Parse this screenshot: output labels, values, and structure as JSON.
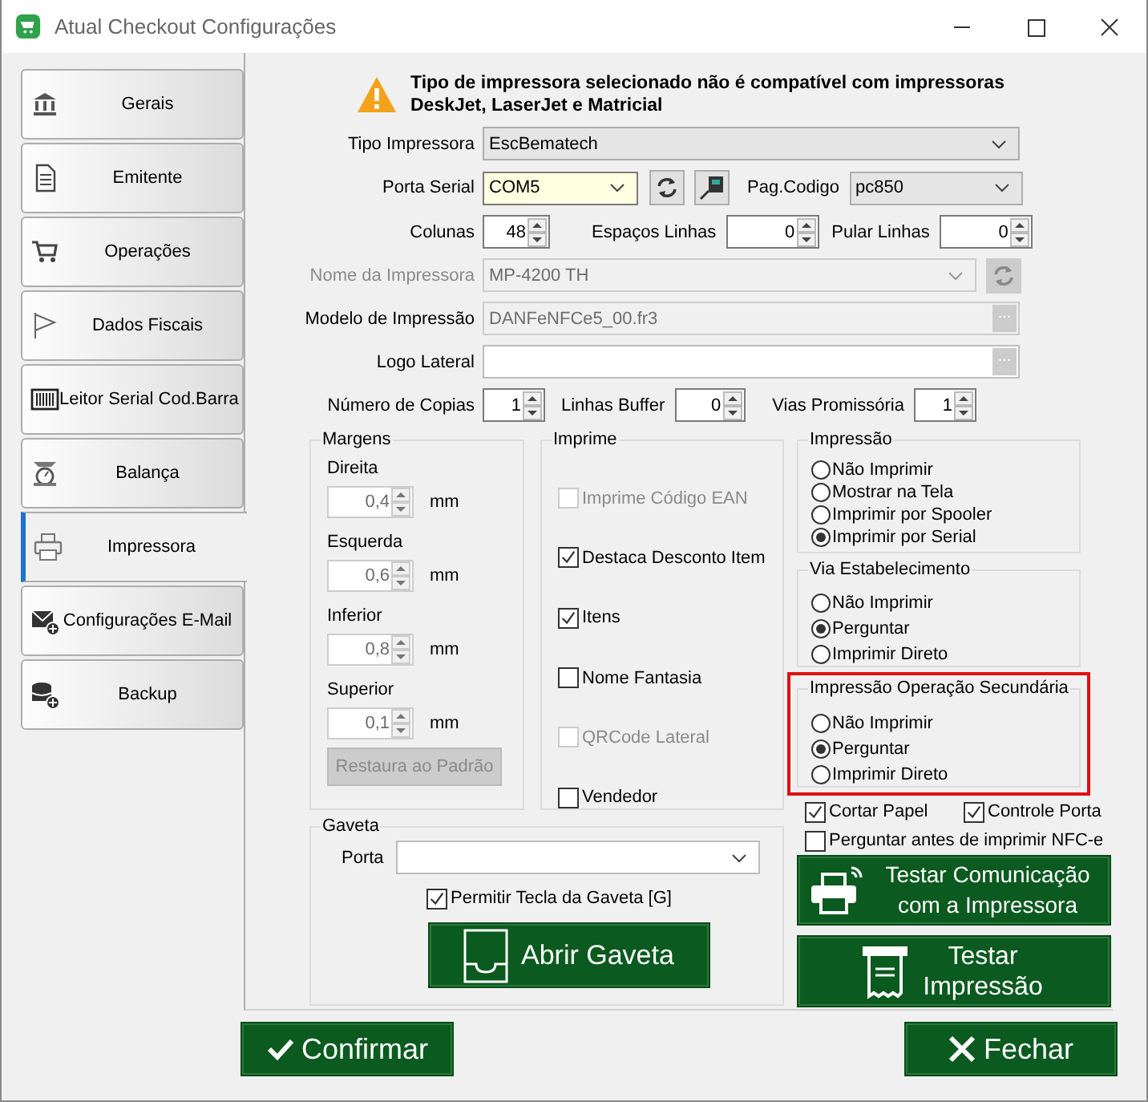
{
  "window": {
    "title": "Atual Checkout Configurações"
  },
  "sidebar": {
    "items": [
      {
        "label": "Gerais",
        "selected": false
      },
      {
        "label": "Emitente",
        "selected": false
      },
      {
        "label": "Operações",
        "selected": false
      },
      {
        "label": "Dados Fiscais",
        "selected": false
      },
      {
        "label": "Leitor Serial Cod.Barra",
        "selected": false
      },
      {
        "label": "Balança",
        "selected": false
      },
      {
        "label": "Impressora",
        "selected": true
      },
      {
        "label": "Configurações E-Mail",
        "selected": false
      },
      {
        "label": "Backup",
        "selected": false
      }
    ]
  },
  "warning": {
    "text": "Tipo de impressora selecionado não é compatível com impressoras DeskJet, LaserJet e Matricial"
  },
  "printer_type": {
    "label": "Tipo Impressora",
    "value": "EscBematech"
  },
  "serial_port": {
    "label": "Porta Serial",
    "value": "COM5"
  },
  "code_page": {
    "label": "Pag.Codigo",
    "value": "pc850"
  },
  "layout_row": [
    {
      "label": "Colunas",
      "value": "48"
    },
    {
      "label": "Espaços Linhas",
      "value": "0"
    },
    {
      "label": "Pular Linhas",
      "value": "0"
    }
  ],
  "printer_name": {
    "label": "Nome da Impressora",
    "value": "MP-4200 TH",
    "disabled": true
  },
  "print_model": {
    "label": "Modelo de Impressão",
    "value": "DANFeNFCe5_00.fr3",
    "disabled": true,
    "button_text": "..."
  },
  "side_logo": {
    "label": "Logo Lateral",
    "disabled": false,
    "button_text": "..."
  },
  "copies_row": [
    {
      "label": "Número de Copias",
      "value": "1"
    },
    {
      "label": "Linhas Buffer",
      "value": "0"
    },
    {
      "label": "Vias Promissória",
      "value": "1"
    }
  ],
  "margins": {
    "title": "Margens",
    "disabled": true,
    "items": [
      {
        "label": "Direita",
        "value": "0,4",
        "unit": "mm"
      },
      {
        "label": "Esquerda",
        "value": "0,6",
        "unit": "mm"
      },
      {
        "label": "Inferior",
        "value": "0,8",
        "unit": "mm"
      },
      {
        "label": "Superior",
        "value": "0,1",
        "unit": "mm"
      }
    ],
    "reset_button": {
      "label": "Restaura ao Padrão",
      "disabled": true
    }
  },
  "prints": {
    "title": "Imprime",
    "items": [
      {
        "label": "Imprime Código EAN",
        "checked": false,
        "disabled": true
      },
      {
        "label": "Destaca Desconto Item",
        "checked": true,
        "disabled": false
      },
      {
        "label": "Itens",
        "checked": true,
        "disabled": false
      },
      {
        "label": "Nome Fantasia",
        "checked": false,
        "disabled": false
      },
      {
        "label": "QRCode Lateral",
        "checked": false,
        "disabled": true
      },
      {
        "label": "Vendedor",
        "checked": false,
        "disabled": false
      }
    ]
  },
  "radio_groups": [
    {
      "title": "Impressão",
      "highlighted": false,
      "options": [
        {
          "label": "Não Imprimir",
          "selected": false
        },
        {
          "label": "Mostrar na Tela",
          "selected": false
        },
        {
          "label": "Imprimir por Spooler",
          "selected": false
        },
        {
          "label": "Imprimir por Serial",
          "selected": true
        }
      ]
    },
    {
      "title": "Via Estabelecimento",
      "highlighted": false,
      "options": [
        {
          "label": "Não Imprimir",
          "selected": false
        },
        {
          "label": "Perguntar",
          "selected": true
        },
        {
          "label": "Imprimir Direto",
          "selected": false
        }
      ]
    },
    {
      "title": "Impressão Operação Secundária",
      "highlighted": true,
      "options": [
        {
          "label": "Não Imprimir",
          "selected": false
        },
        {
          "label": "Perguntar",
          "selected": true
        },
        {
          "label": "Imprimir Direto",
          "selected": false
        }
      ]
    }
  ],
  "option_checks": [
    {
      "label": "Cortar Papel",
      "checked": true
    },
    {
      "label": "Controle Porta",
      "checked": true
    },
    {
      "label": "Perguntar antes de imprimir NFC-e",
      "checked": false
    }
  ],
  "drawer": {
    "title": "Gaveta",
    "port_label": "Porta",
    "allow_key": {
      "label": "Permitir Tecla da Gaveta [G]",
      "checked": true
    },
    "open_button": "Abrir Gaveta"
  },
  "test_buttons": [
    {
      "label": "Testar Comunicação com a Impressora",
      "kind": "communication"
    },
    {
      "label": "Testar Impressão",
      "kind": "print"
    }
  ],
  "footer": {
    "confirm": "Confirmar",
    "close": "Fechar"
  }
}
